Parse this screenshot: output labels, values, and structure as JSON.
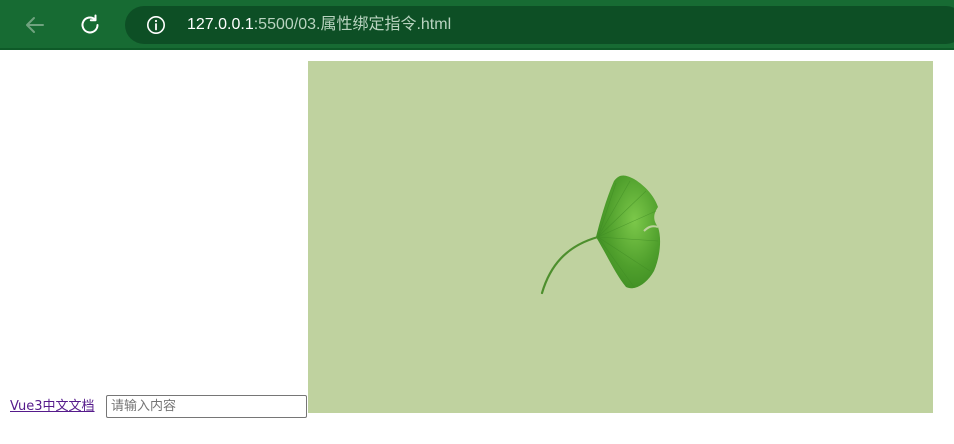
{
  "browser": {
    "url_host": "127.0.0.1",
    "url_path": ":5500/03.属性绑定指令.html",
    "colors": {
      "toolbar": "#176b33",
      "address_bar": "#0d4f25"
    }
  },
  "page": {
    "link_text": "Vue3中文文档",
    "input": {
      "value": "",
      "placeholder": "请输入内容"
    },
    "image": {
      "background": "#bfd29f",
      "subject": "ginkgo-leaf"
    }
  },
  "icons": {
    "back": "back-arrow-icon",
    "reload": "reload-icon",
    "info": "info-icon"
  }
}
